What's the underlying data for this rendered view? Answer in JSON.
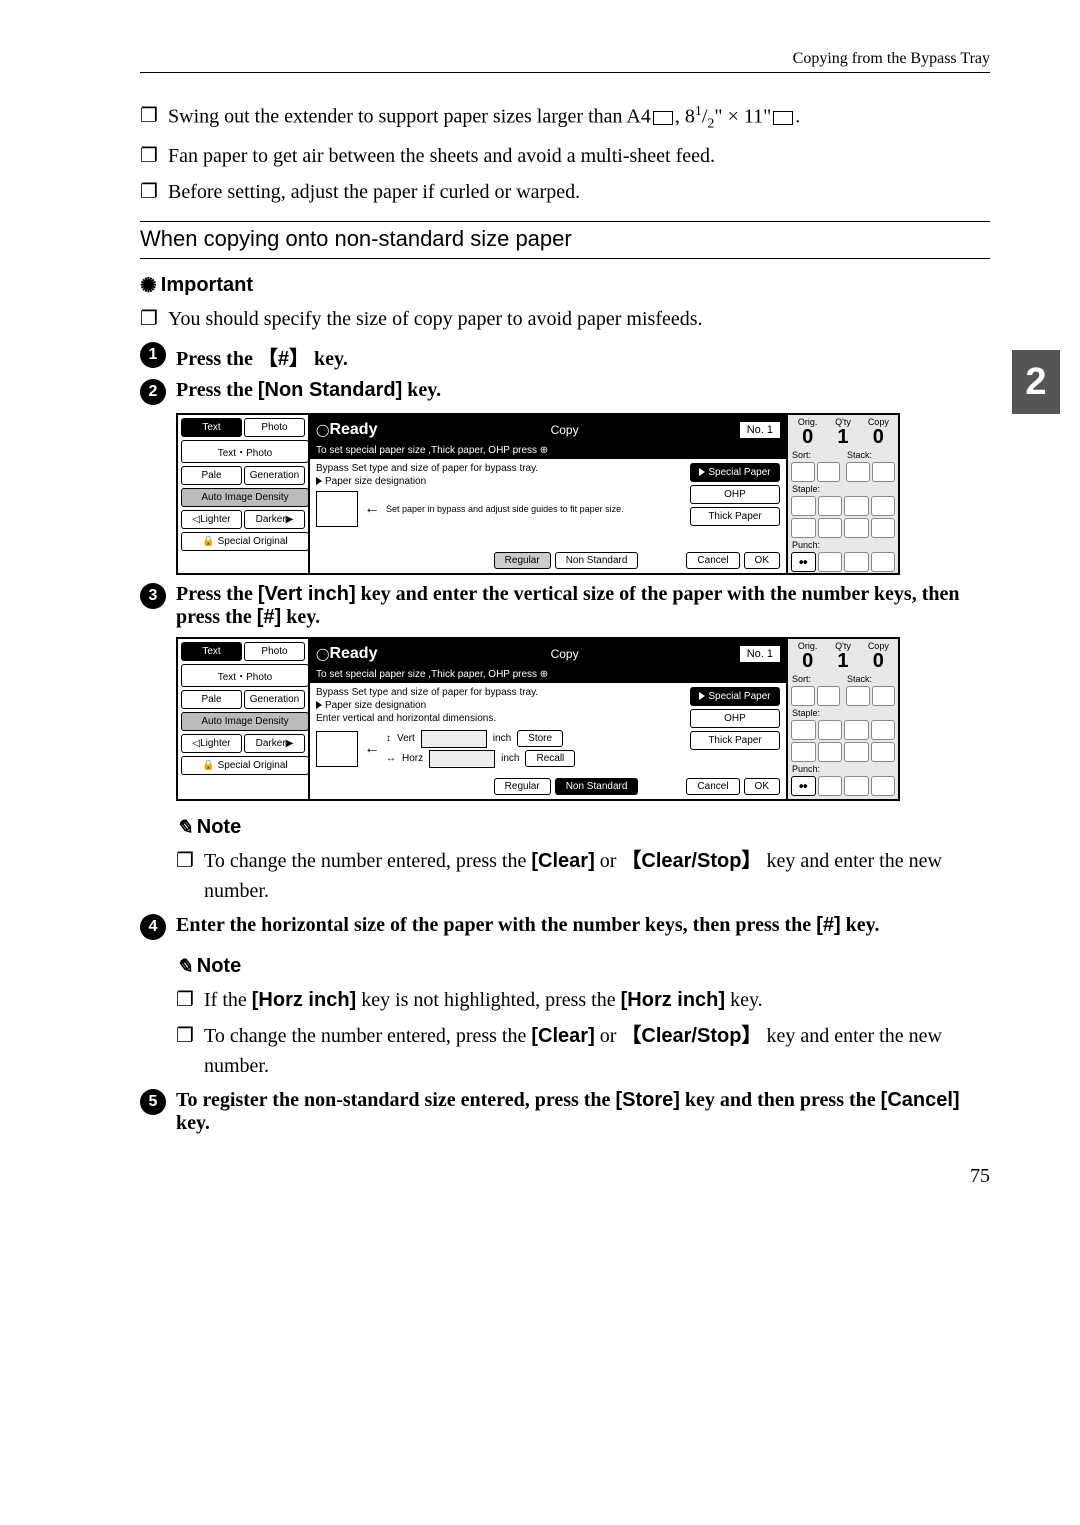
{
  "header": {
    "title": "Copying from the Bypass Tray"
  },
  "sideTab": "2",
  "bullets_top": [
    "Swing out the extender to support paper sizes larger than A4▢, 8¹⁄₂\" × 11\"▢.",
    "Fan paper to get air between the sheets and avoid a multi-sheet feed.",
    "Before setting, adjust the paper if curled or warped."
  ],
  "nonstd_title": "When copying onto non-standard size paper",
  "important": {
    "label": "Important",
    "text": "You should specify the size of copy paper to avoid paper misfeeds."
  },
  "steps": {
    "s1": {
      "num": "1",
      "pre": "Press the ",
      "key": "#",
      "post": " key."
    },
    "s2": {
      "num": "2",
      "pre": "Press the ",
      "key": "[Non Standard]",
      "post": " key."
    },
    "s3": {
      "num": "3",
      "pre": "Press the ",
      "key": "[Vert inch]",
      "mid": " key and enter the vertical size of the paper with the number keys, then press the ",
      "key2": "[#]",
      "post": " key."
    },
    "s4": {
      "num": "4",
      "pre": "Enter the horizontal size of the paper with the number keys, then press the ",
      "key": "[#]",
      "post": " key."
    },
    "s5": {
      "num": "5",
      "pre": "To register the non-standard size entered, press the ",
      "key": "[Store]",
      "mid": " key and then press the ",
      "key2": "[Cancel]",
      "post": " key."
    }
  },
  "note1": {
    "label": "Note",
    "text_pre": "To change the number entered, press the ",
    "key1": "[Clear]",
    "text_or": " or ",
    "key2": "Clear/Stop",
    "text_post": " key and enter the new number."
  },
  "note2": {
    "label": "Note",
    "line1_pre": "If the ",
    "line1_key1": "[Horz inch]",
    "line1_mid": " key is not highlighted, press the ",
    "line1_key2": "[Horz inch]",
    "line1_post": " key.",
    "line2_pre": "To change the number entered, press the ",
    "line2_key1": "[Clear]",
    "line2_or": " or ",
    "line2_key2": "Clear/Stop",
    "line2_post": " key and enter the new number."
  },
  "pageNumber": "75",
  "panel": {
    "ready": "Ready",
    "copyLabel": "Copy",
    "noLabel": "No. 1",
    "substatus": "To set special paper size ,Thick paper, OHP press ⊕",
    "left": {
      "text": "Text",
      "photo": "Photo",
      "textphoto": "Text・Photo",
      "pale": "Pale",
      "generation": "Generation",
      "autodensity": "Auto Image Density",
      "lighter": "Lighter",
      "darker": "Darker",
      "special": "Special Original"
    },
    "main1": {
      "bypass": "Bypass  Set type and size of paper for bypass tray.",
      "papersize": "Paper size designation",
      "guides": "Set paper in bypass and adjust side guides to fit paper size.",
      "regular": "Regular",
      "nonstd": "Non Standard",
      "cancel": "Cancel",
      "ok": "OK",
      "specialp": "Special Paper",
      "ohp": "OHP",
      "thick": "Thick Paper"
    },
    "main2": {
      "enterdims": "Enter vertical and horizontal dimensions.",
      "vert": "Vert",
      "horz": "Horz",
      "inch": "inch",
      "store": "Store",
      "recall": "Recall"
    },
    "counters": {
      "orig": "Orig.",
      "qty": "Q'ty",
      "copy": "Copy",
      "v0": "0",
      "v1": "1",
      "v0b": "0"
    },
    "right": {
      "sort": "Sort:",
      "stack": "Stack:",
      "staple": "Staple:",
      "punch": "Punch:"
    }
  }
}
